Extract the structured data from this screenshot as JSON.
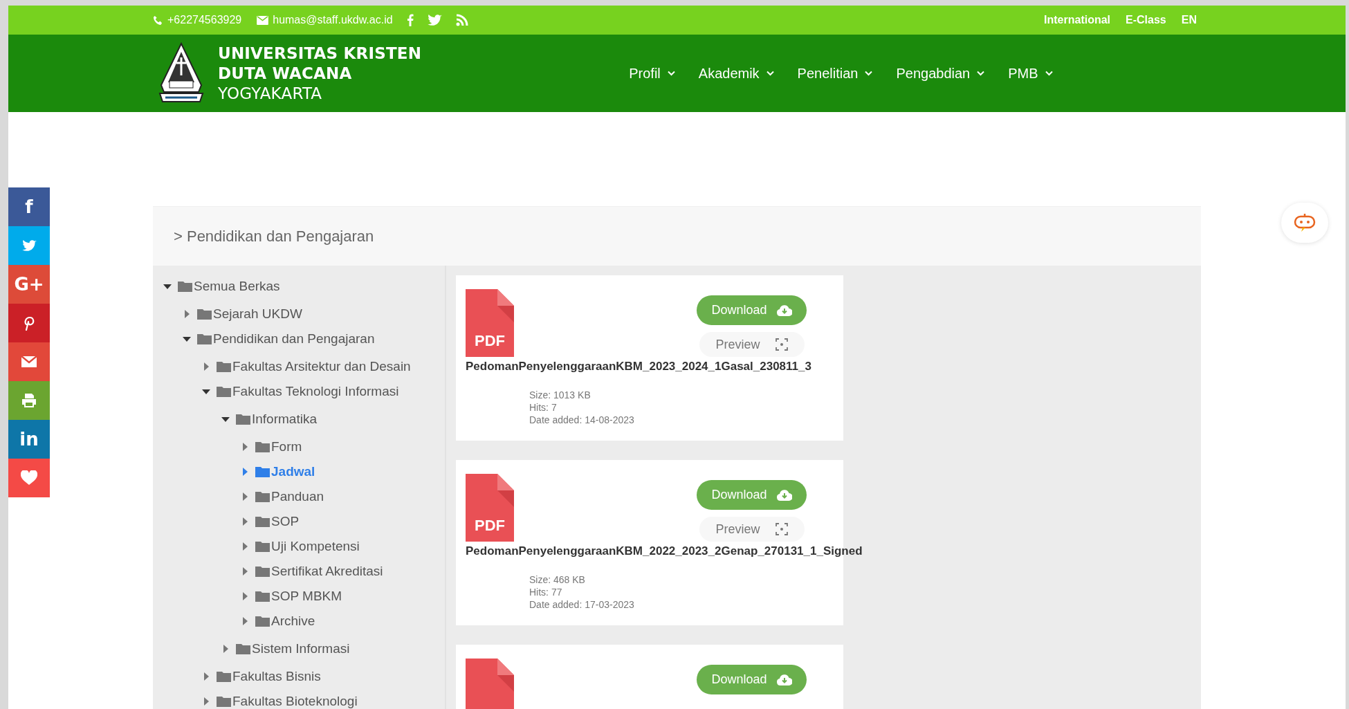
{
  "top_bar": {
    "phone": "+62274563929",
    "email": "humas@staff.ukdw.ac.id",
    "social_icons": [
      {
        "kind": "facebook"
      },
      {
        "kind": "twitter"
      },
      {
        "kind": "rss"
      }
    ],
    "links": [
      "International",
      "E-Class",
      "EN"
    ]
  },
  "header": {
    "logo_lines": [
      {
        "text": "UNIVERSITAS KRISTEN",
        "bold": true
      },
      {
        "text": "DUTA WACANA",
        "bold": true
      },
      {
        "text": "YOGYAKARTA",
        "bold": false
      }
    ],
    "nav": [
      {
        "label": "Profil"
      },
      {
        "label": "Akademik"
      },
      {
        "label": "Penelitian"
      },
      {
        "label": "Pengabdian"
      },
      {
        "label": "PMB"
      }
    ]
  },
  "social_bar": [
    {
      "kind": "glyph",
      "glyph": "f",
      "color": "#3b5998"
    },
    {
      "kind": "twitter",
      "color": "#00abeb"
    },
    {
      "kind": "glyph",
      "glyph": "G+",
      "color": "#dd4b39"
    },
    {
      "kind": "pinterest",
      "color": "#cb2027"
    },
    {
      "kind": "email",
      "color": "#e2483a"
    },
    {
      "kind": "print",
      "color": "#6ba530"
    },
    {
      "kind": "glyph",
      "glyph": "in",
      "color": "#0e76a8"
    },
    {
      "kind": "heart",
      "color": "#f44a46"
    }
  ],
  "breadcrumb": "> Pendidikan dan Pengajaran",
  "tree": [
    {
      "label": "Semua Berkas",
      "expanded": true,
      "selected": false,
      "children": [
        {
          "label": "Sejarah UKDW",
          "expanded": false,
          "selected": false
        },
        {
          "label": "Pendidikan dan Pengajaran",
          "expanded": true,
          "selected": false,
          "children": [
            {
              "label": "Fakultas Arsitektur dan Desain",
              "expanded": false,
              "selected": false
            },
            {
              "label": "Fakultas Teknologi Informasi",
              "expanded": true,
              "selected": false,
              "children": [
                {
                  "label": "Informatika",
                  "expanded": true,
                  "selected": false,
                  "children": [
                    {
                      "label": "Form",
                      "expanded": false,
                      "selected": false
                    },
                    {
                      "label": "Jadwal",
                      "expanded": false,
                      "selected": true
                    },
                    {
                      "label": "Panduan",
                      "expanded": false,
                      "selected": false
                    },
                    {
                      "label": "SOP",
                      "expanded": false,
                      "selected": false
                    },
                    {
                      "label": "Uji Kompetensi",
                      "expanded": false,
                      "selected": false
                    },
                    {
                      "label": "Sertifikat Akreditasi",
                      "expanded": false,
                      "selected": false
                    },
                    {
                      "label": "SOP MBKM",
                      "expanded": false,
                      "selected": false
                    },
                    {
                      "label": "Archive",
                      "expanded": false,
                      "selected": false
                    }
                  ]
                },
                {
                  "label": "Sistem Informasi",
                  "expanded": false,
                  "selected": false
                }
              ]
            },
            {
              "label": "Fakultas Bisnis",
              "expanded": false,
              "selected": false
            },
            {
              "label": "Fakultas Bioteknologi",
              "expanded": false,
              "selected": false
            }
          ]
        }
      ]
    }
  ],
  "files": [
    {
      "type_label": "PDF",
      "download_label": "Download",
      "preview_label": "Preview",
      "name": "PedomanPenyelenggaraanKBM_2023_2024_1Gasal_230811_3",
      "size": "Size: 1013 KB",
      "hits": "Hits: 7",
      "date": "Date added: 14-08-2023"
    },
    {
      "type_label": "PDF",
      "download_label": "Download",
      "preview_label": "Preview",
      "name": "PedomanPenyelenggaraanKBM_2022_2023_2Genap_270131_1_Signed",
      "size": "Size: 468 KB",
      "hits": "Hits: 77",
      "date": "Date added: 17-03-2023"
    },
    {
      "download_label": "Download"
    }
  ]
}
